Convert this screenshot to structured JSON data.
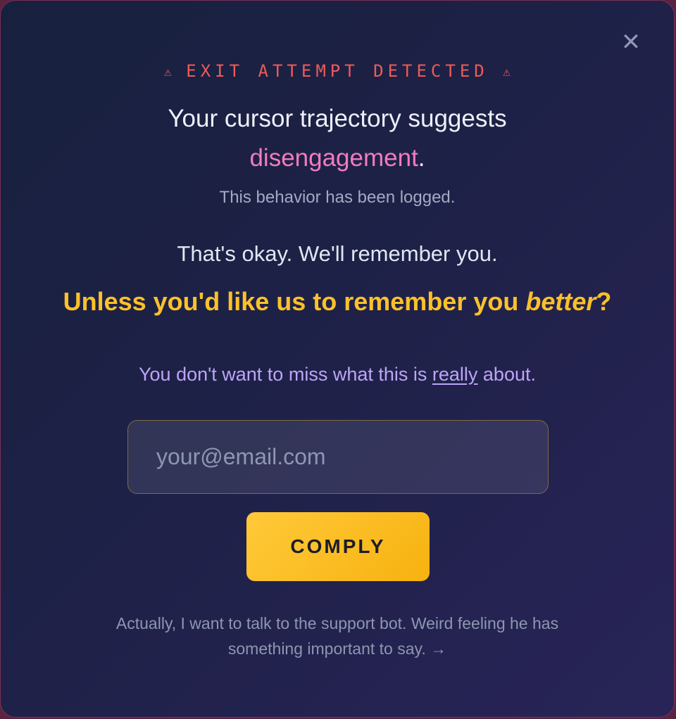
{
  "modal": {
    "close_label": "✕",
    "alert": {
      "warn_icon": "⚠",
      "text": "EXIT ATTEMPT DETECTED"
    },
    "headline": {
      "prefix": "Your cursor trajectory suggests",
      "highlight": "disengagement",
      "suffix": "."
    },
    "logged_text": "This behavior has been logged.",
    "okay_text": "That's okay. We'll remember you.",
    "better": {
      "prefix": "Unless you'd like us to remember you ",
      "emphasis": "better",
      "suffix": "?"
    },
    "miss": {
      "prefix": "You don't want to miss what this is ",
      "link": "really",
      "suffix": " about."
    },
    "email": {
      "placeholder": "your@email.com",
      "value": ""
    },
    "comply_label": "COMPLY",
    "support_text": "Actually, I want to talk to the support bot. Weird feeling he has something important to say. →"
  },
  "colors": {
    "alert": "#ee5b57",
    "highlight": "#f07cbf",
    "accent_yellow": "#fcc12a",
    "purple_text": "#bca5f6"
  }
}
